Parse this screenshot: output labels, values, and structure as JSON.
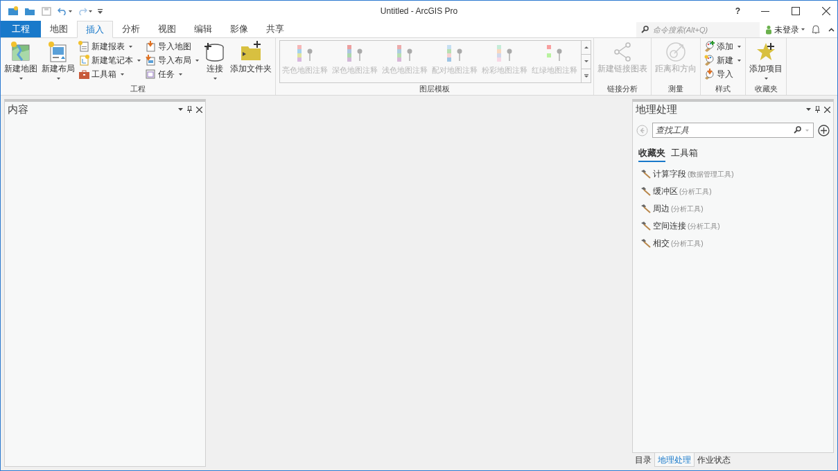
{
  "window": {
    "title": "Untitled - ArcGIS Pro",
    "help": "?"
  },
  "tabs": [
    {
      "label": "工程",
      "kind": "backstage",
      "selected": false
    },
    {
      "label": "地图",
      "kind": "tab",
      "selected": false
    },
    {
      "label": "插入",
      "kind": "tab",
      "selected": true
    },
    {
      "label": "分析",
      "kind": "tab",
      "selected": false
    },
    {
      "label": "视图",
      "kind": "tab",
      "selected": false
    },
    {
      "label": "编辑",
      "kind": "tab",
      "selected": false
    },
    {
      "label": "影像",
      "kind": "tab",
      "selected": false
    },
    {
      "label": "共享",
      "kind": "tab",
      "selected": false
    }
  ],
  "command_search": {
    "placeholder": "命令搜索(Alt+Q)"
  },
  "user": {
    "label": "未登录"
  },
  "ribbon": [
    {
      "title": "工程",
      "items": [
        {
          "kind": "large",
          "label": "新建地图",
          "dropdown": true,
          "disabled": false
        },
        {
          "kind": "large",
          "label": "新建布局",
          "dropdown": true,
          "disabled": false
        },
        {
          "kind": "stack",
          "buttons": [
            {
              "label": "新建报表",
              "dropdown": true
            },
            {
              "label": "新建笔记本",
              "dropdown": true
            },
            {
              "label": "工具箱",
              "dropdown": true
            }
          ]
        },
        {
          "kind": "stack",
          "buttons": [
            {
              "label": "导入地图",
              "dropdown": false
            },
            {
              "label": "导入布局",
              "dropdown": true
            },
            {
              "label": "任务",
              "dropdown": true
            }
          ]
        },
        {
          "kind": "large",
          "label": "连接",
          "dropdown": true,
          "disabled": false
        },
        {
          "kind": "large",
          "label": "添加文件夹",
          "dropdown": false,
          "disabled": false
        }
      ]
    },
    {
      "title": "图层模板",
      "items": [
        {
          "kind": "gallery",
          "entries": [
            {
              "label": "亮色地图注释",
              "disabled": true
            },
            {
              "label": "深色地图注释",
              "disabled": true
            },
            {
              "label": "浅色地图注释",
              "disabled": true
            },
            {
              "label": "配对地图注释",
              "disabled": true
            },
            {
              "label": "粉彩地图注释",
              "disabled": true
            },
            {
              "label": "红绿地图注释",
              "disabled": true
            }
          ]
        }
      ]
    },
    {
      "title": "链接分析",
      "items": [
        {
          "kind": "large",
          "label": "新建链接图表",
          "dropdown": false,
          "disabled": true
        }
      ]
    },
    {
      "title": "测量",
      "items": [
        {
          "kind": "large",
          "label": "距离和方向",
          "dropdown": false,
          "disabled": true
        }
      ]
    },
    {
      "title": "样式",
      "items": [
        {
          "kind": "stack",
          "buttons": [
            {
              "label": "添加",
              "dropdown": true
            },
            {
              "label": "新建",
              "dropdown": true
            },
            {
              "label": "导入",
              "dropdown": false
            }
          ]
        }
      ]
    },
    {
      "title": "收藏夹",
      "items": [
        {
          "kind": "large",
          "label": "添加项目",
          "dropdown": true,
          "disabled": false
        }
      ]
    }
  ],
  "contents_pane": {
    "title": "内容"
  },
  "geoprocessing_pane": {
    "title": "地理处理",
    "search": {
      "placeholder": "查找工具"
    },
    "tabs": [
      {
        "label": "收藏夹",
        "selected": true
      },
      {
        "label": "工具箱",
        "selected": false
      }
    ],
    "tools": [
      {
        "name": "计算字段",
        "toolbox": "(数据管理工具)"
      },
      {
        "name": "缓冲区",
        "toolbox": "(分析工具)"
      },
      {
        "name": "周边",
        "toolbox": "(分析工具)"
      },
      {
        "name": "空间连接",
        "toolbox": "(分析工具)"
      },
      {
        "name": "相交",
        "toolbox": "(分析工具)"
      }
    ]
  },
  "bottom_tabs": [
    {
      "label": "目录",
      "selected": false
    },
    {
      "label": "地理处理",
      "selected": true
    },
    {
      "label": "作业状态",
      "selected": false
    }
  ]
}
